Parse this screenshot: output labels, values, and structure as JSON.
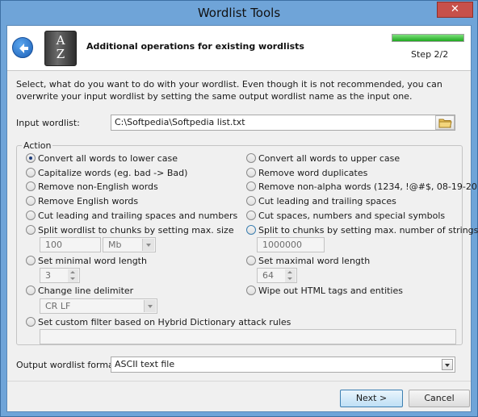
{
  "window": {
    "title": "Wordlist Tools",
    "close_glyph": "✕"
  },
  "header": {
    "icon": "az-book-icon",
    "icon_text_top": "A",
    "icon_text_bottom": "Z",
    "title": "Additional operations for existing wordlists",
    "step": "Step 2/2",
    "progress": 1.0
  },
  "description": "Select, what do you want to do with your wordlist. Even though it is not recommended, you can overwrite your input wordlist by setting the same output wordlist name as the input one.",
  "input": {
    "label": "Input wordlist:",
    "value": "C:\\Softpedia\\Softpedia list.txt"
  },
  "action": {
    "legend": "Action",
    "options": [
      {
        "key": "lower",
        "label": "Convert all words to lower case",
        "checked": true
      },
      {
        "key": "upper",
        "label": "Convert all words to upper case",
        "checked": false
      },
      {
        "key": "capitalize",
        "label": "Capitalize words (eg. bad -> Bad)",
        "checked": false
      },
      {
        "key": "dupes",
        "label": "Remove word duplicates",
        "checked": false
      },
      {
        "key": "non_english",
        "label": "Remove non-English words",
        "checked": false
      },
      {
        "key": "non_alpha",
        "label": "Remove non-alpha words (1234, !@#$, 08-19-20...",
        "checked": false
      },
      {
        "key": "english",
        "label": "Remove English words",
        "checked": false
      },
      {
        "key": "cut_lead",
        "label": "Cut leading and trailing spaces",
        "checked": false
      },
      {
        "key": "cut_lead_num",
        "label": "Cut leading and trailing spaces and numbers",
        "checked": false
      },
      {
        "key": "cut_special",
        "label": "Cut spaces, numbers and special symbols",
        "checked": false
      },
      {
        "key": "split_size",
        "label": "Split wordlist to chunks by setting max. size",
        "checked": false
      },
      {
        "key": "split_strings",
        "label": "Split to chunks by setting max. number of strings",
        "checked": false
      },
      {
        "key": "min_len",
        "label": "Set minimal word length",
        "checked": false
      },
      {
        "key": "max_len",
        "label": "Set maximal word length",
        "checked": false
      },
      {
        "key": "delim",
        "label": "Change line delimiter",
        "checked": false
      },
      {
        "key": "html",
        "label": "Wipe out HTML tags and entities",
        "checked": false
      },
      {
        "key": "filter",
        "label": "Set custom filter based on Hybrid Dictionary attack rules",
        "checked": false
      }
    ],
    "split_size_value": "100",
    "split_size_unit": "Mb",
    "split_strings_value": "1000000",
    "min_length_value": "3",
    "max_length_value": "64",
    "delimiter_value": "CR LF",
    "filter_value": ""
  },
  "output": {
    "label": "Output wordlist format:",
    "value": "ASCII text file"
  },
  "buttons": {
    "next": "Next >",
    "cancel": "Cancel"
  }
}
